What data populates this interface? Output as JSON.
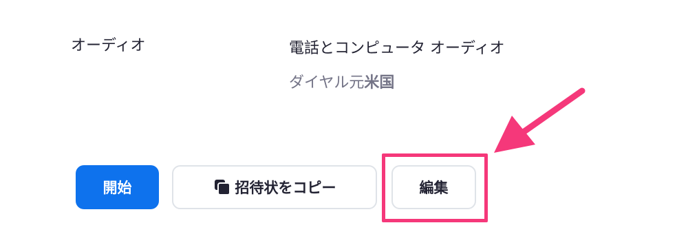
{
  "audio": {
    "label": "オーディオ",
    "value": "電話とコンピュータ オーディオ",
    "dial_prefix": "ダイヤル元",
    "dial_country": "米国"
  },
  "actions": {
    "start_label": "開始",
    "copy_invitation_label": "招待状をコピー",
    "copy_icon": "copy-icon",
    "edit_label": "編集"
  },
  "annotation": {
    "highlight_color": "#f5387a",
    "highlight_target": "edit-button"
  },
  "colors": {
    "primary_blue": "#0e72ed",
    "text_dark": "#232333",
    "text_gray": "#747487",
    "border_gray": "#dfe3e8"
  }
}
